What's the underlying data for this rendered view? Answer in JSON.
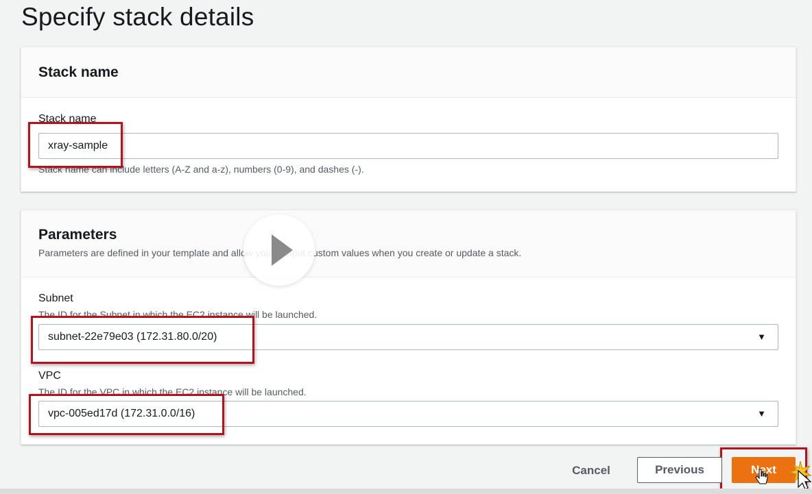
{
  "page": {
    "title": "Specify stack details"
  },
  "stack_name_section": {
    "title": "Stack name",
    "field_label": "Stack name",
    "value": "xray-sample",
    "hint": "Stack name can include letters (A-Z and a-z), numbers (0-9), and dashes (-)."
  },
  "parameters_section": {
    "title": "Parameters",
    "description": "Parameters are defined in your template and allow you to input custom values when you create or update a stack.",
    "subnet": {
      "label": "Subnet",
      "description": "The ID for the Subnet in which the EC2 instance will be launched.",
      "selected": "subnet-22e79e03 (172.31.80.0/20)"
    },
    "vpc": {
      "label": "VPC",
      "description": "The ID for the VPC in which the EC2 instance will be launched.",
      "selected": "vpc-005ed17d (172.31.0.0/16)"
    }
  },
  "actions": {
    "cancel": "Cancel",
    "previous": "Previous",
    "next": "Next"
  },
  "icons": {
    "caret": "caret-down-icon",
    "play": "play-icon",
    "cursor": "pointer-cursor-icon"
  },
  "colors": {
    "primary_button": "#ec7211",
    "highlight": "#b5121b",
    "background": "#f2f3f3"
  }
}
